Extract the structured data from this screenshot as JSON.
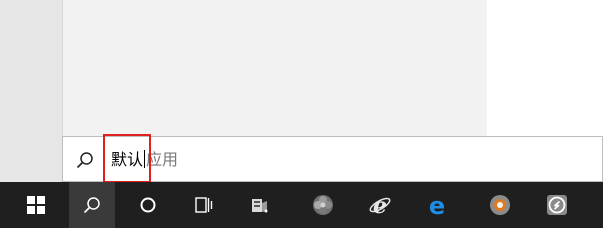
{
  "search": {
    "typed_text": "默认",
    "suggestion_text": "应用",
    "icon": "search-icon"
  },
  "taskbar": {
    "items": [
      {
        "name": "start",
        "icon": "windows-logo-icon"
      },
      {
        "name": "search",
        "icon": "search-icon",
        "active": true
      },
      {
        "name": "cortana",
        "icon": "cortana-circle-icon"
      },
      {
        "name": "task-view",
        "icon": "task-view-icon"
      },
      {
        "name": "app-1",
        "icon": "app-icon"
      },
      {
        "name": "app-2",
        "icon": "flower-icon"
      },
      {
        "name": "internet-explorer",
        "icon": "ie-icon"
      },
      {
        "name": "edge",
        "icon": "edge-icon"
      },
      {
        "name": "app-3",
        "icon": "orange-circle-icon"
      },
      {
        "name": "app-4",
        "icon": "green-s-icon"
      }
    ]
  },
  "colors": {
    "taskbar_bg": "#1f1f1f",
    "highlight": "#e02020",
    "ie_blue": "#1e8de6",
    "orange": "#f39c12",
    "green": "#2ecc71"
  }
}
